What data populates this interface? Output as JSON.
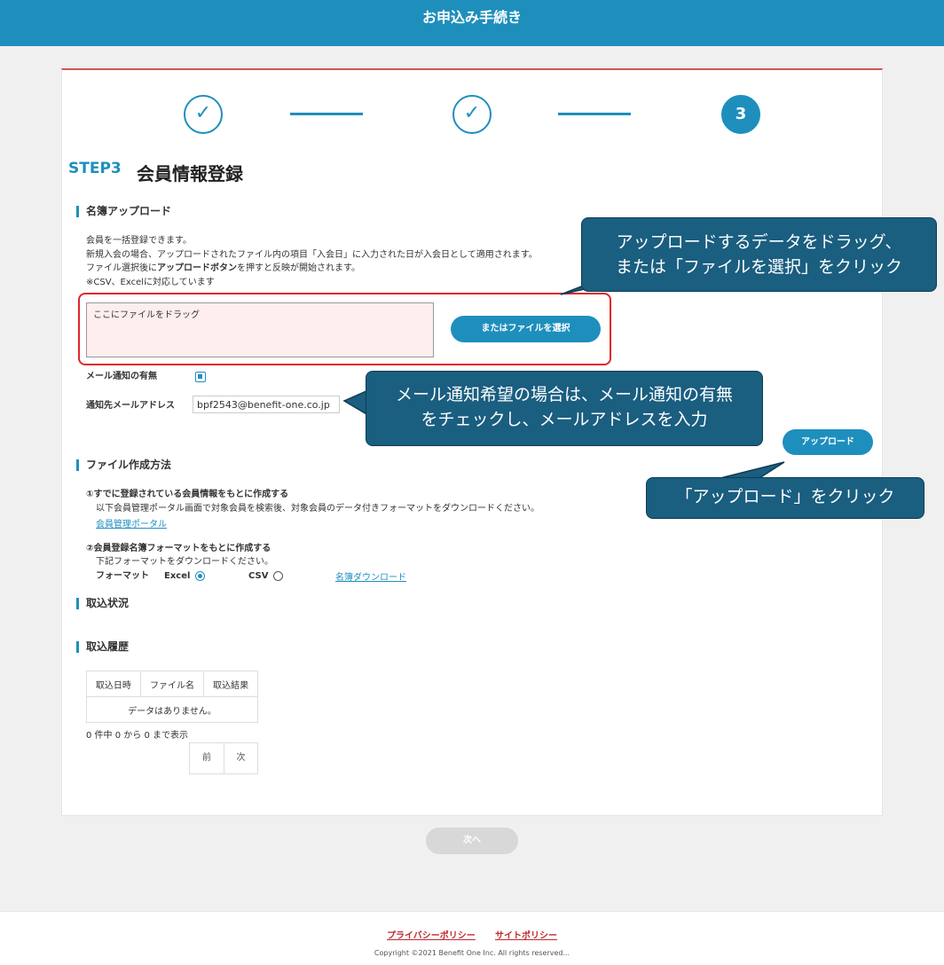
{
  "header": {
    "title": "お申込み手続き"
  },
  "steps": {
    "step3_number": "3",
    "check_glyph": "✓"
  },
  "heading": {
    "step_label": "STEP3",
    "title": "会員情報登録"
  },
  "upload_section": {
    "title": "名簿アップロード",
    "desc": [
      "会員を一括登録できます。",
      "新規入会の場合、アップロードされたファイル内の項目「入会日」に入力された日が入会日として適用されます。",
      "ファイル選択後に",
      "アップロードボタン",
      "を押すと反映が開始されます。",
      "※CSV、Excelに対応しています"
    ],
    "drop_text": "ここにファイルをドラッグ",
    "select_button": "またはファイルを選択",
    "notify_label": "メール通知の有無",
    "email_label": "通知先メールアドレス",
    "email_value": "bpf2543@benefit-one.co.jp",
    "upload_button": "アップロード"
  },
  "file_method": {
    "title": "ファイル作成方法",
    "item1_title": "①すでに登録されている会員情報をもとに作成する",
    "item1_desc": "以下会員管理ポータル画面で対象会員を検索後、対象会員のデータ付きフォーマットをダウンロードください。",
    "item1_link": "会員管理ポータル",
    "item2_title": "②会員登録名簿フォーマットをもとに作成する",
    "item2_desc": "下記フォーマットをダウンロードください。",
    "format_label": "フォーマット",
    "opt_excel": "Excel",
    "opt_csv": "CSV",
    "download_link": "名簿ダウンロード"
  },
  "status_section": {
    "title": "取込状況"
  },
  "history_section": {
    "title": "取込履歴",
    "columns": [
      "取込日時",
      "ファイル名",
      "取込結果"
    ],
    "empty": "データはありません。",
    "info": "0 件中 0 から 0 まで表示",
    "prev": "前",
    "next": "次"
  },
  "next_button": "次へ",
  "callouts": {
    "drag_line1": "アップロードするデータをドラッグ、",
    "drag_line2": "または「ファイルを選択」をクリック",
    "mail_line1": "メール通知希望の場合は、メール通知の有無",
    "mail_line2": "をチェックし、メールアドレスを入力",
    "upload": "「アップロード」をクリック"
  },
  "footer": {
    "privacy": "プライバシーポリシー",
    "site": "サイトポリシー",
    "copyright": "Copyright ©2021 Benefit One Inc. All rights reserved..."
  },
  "colors": {
    "brand": "#1e8fbd",
    "callout": "#1a5e80",
    "highlight": "#e0262b"
  }
}
